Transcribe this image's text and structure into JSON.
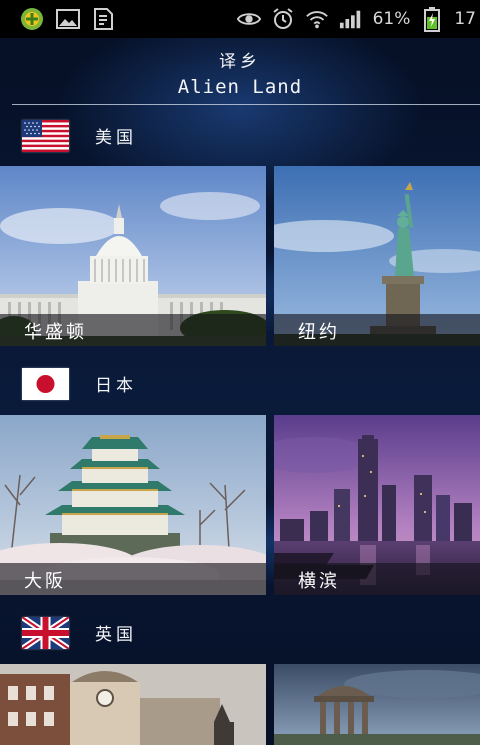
{
  "status_bar": {
    "battery_percent": "61%",
    "clock": "17",
    "left_icons": [
      "app-icon",
      "image-icon",
      "document-icon"
    ],
    "right_icons": [
      "eye-icon",
      "alarm-icon",
      "wifi-icon",
      "signal-icon",
      "battery-icon"
    ]
  },
  "header": {
    "title_cn": "译乡",
    "title_en": "Alien Land"
  },
  "countries": [
    {
      "name": "美国",
      "flag": "usa-flag",
      "cities": [
        {
          "label": "华盛顿"
        },
        {
          "label": "纽约"
        }
      ]
    },
    {
      "name": "日本",
      "flag": "japan-flag",
      "cities": [
        {
          "label": "大阪"
        },
        {
          "label": "横滨"
        }
      ]
    },
    {
      "name": "英国",
      "flag": "uk-flag",
      "cities": [
        {
          "label": ""
        },
        {
          "label": ""
        }
      ]
    }
  ],
  "colors": {
    "background": "#061026",
    "caption_bar": "#14141c",
    "text": "#f2f4f7"
  }
}
